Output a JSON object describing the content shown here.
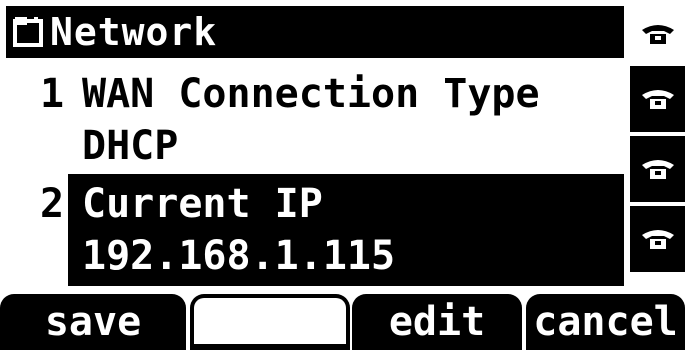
{
  "header": {
    "title": "Network",
    "icon": "folder-icon"
  },
  "menu": {
    "items": [
      {
        "number": "1",
        "label": "WAN Connection Type",
        "value": "DHCP",
        "selected": false
      },
      {
        "number": "2",
        "label": "Current IP",
        "value": "192.168.1.115",
        "selected": true
      }
    ]
  },
  "line_keys": [
    {
      "icon": "phone-icon",
      "highlighted": false
    },
    {
      "icon": "phone-icon",
      "highlighted": true
    },
    {
      "icon": "phone-icon",
      "highlighted": true
    },
    {
      "icon": "phone-icon",
      "highlighted": true
    }
  ],
  "softkeys": [
    {
      "label": "save"
    },
    {
      "label": ""
    },
    {
      "label": "edit"
    },
    {
      "label": "cancel"
    }
  ],
  "colors": {
    "foreground": "#000000",
    "background": "#ffffff"
  }
}
